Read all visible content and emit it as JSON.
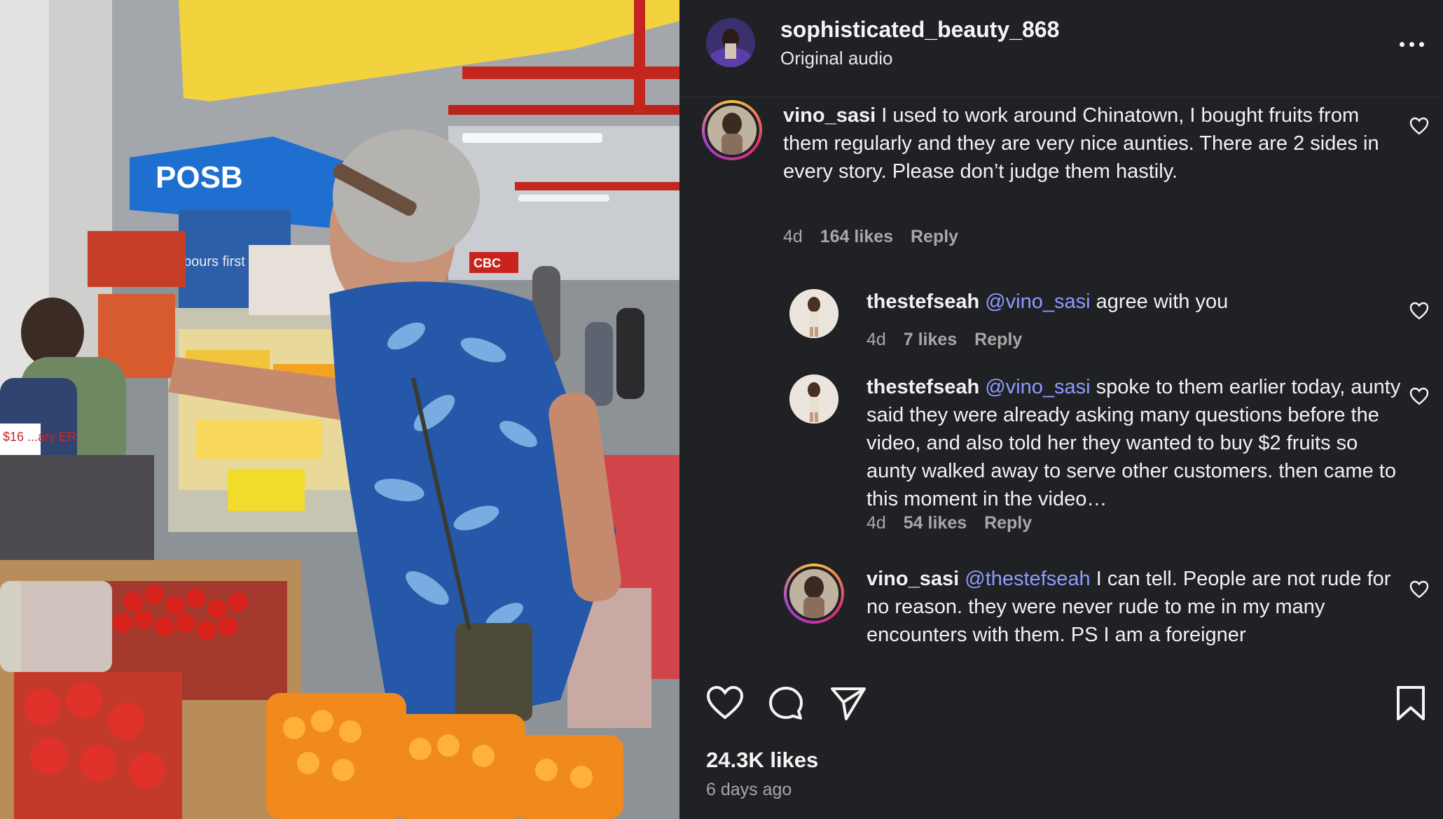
{
  "post": {
    "username": "sophisticated_beauty_868",
    "audio": "Original audio",
    "likes": "24.3K likes",
    "posted": "6 days ago"
  },
  "comments": [
    {
      "username": "vino_sasi",
      "mention": "",
      "text": "I used to work around Chinatown, I bought fruits from them regularly and they are very nice aunties. There are 2 sides in every story. Please don’t judge them hastily.",
      "time": "4d",
      "likes": "164 likes",
      "reply": "Reply"
    },
    {
      "username": "thestefseah",
      "mention": "@vino_sasi",
      "text": "agree with you",
      "time": "4d",
      "likes": "7 likes",
      "reply": "Reply"
    },
    {
      "username": "thestefseah",
      "mention": "@vino_sasi",
      "text": "spoke to them earlier today, aunty said they were already asking many questions before the video, and also told her they wanted to buy $2 fruits so aunty walked away to serve other customers. then came to this moment in the video…",
      "time": "4d",
      "likes": "54 likes",
      "reply": "Reply"
    },
    {
      "username": "vino_sasi",
      "mention": "@thestefseah",
      "text": "I can tell. People are not rude for no reason. they were never rude to me in my many encounters with them. PS I am a foreigner",
      "time": "",
      "likes": "",
      "reply": ""
    }
  ],
  "media": {
    "sign_bank": "POSB",
    "sign_partial": "bours first ers secon",
    "sign_ocbc": "CBC",
    "price_tag": "$16 ...ary ER"
  },
  "icons": {
    "more": "more-options-icon",
    "like": "heart-icon",
    "comment": "comment-icon",
    "share": "send-icon",
    "save": "bookmark-icon"
  },
  "colors": {
    "panel_bg": "#202124",
    "mention": "#8e9bff",
    "muted": "#a8a8a8"
  }
}
